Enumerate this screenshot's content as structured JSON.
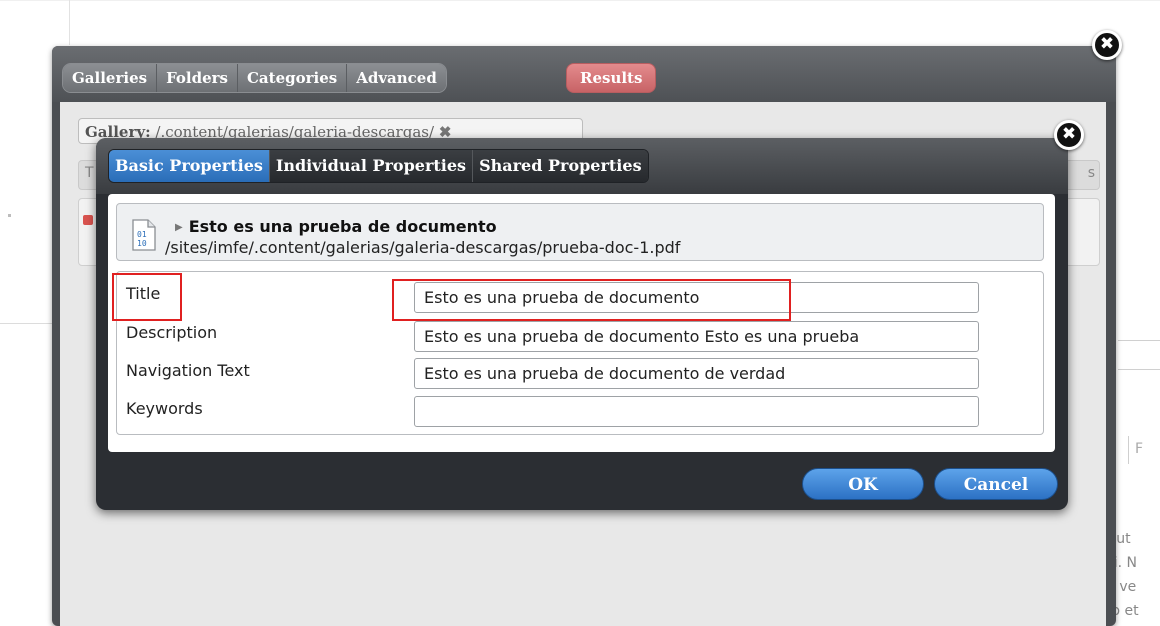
{
  "outer_tabs": [
    "Galleries",
    "Folders",
    "Categories",
    "Advanced"
  ],
  "results_tab": "Results",
  "filter": {
    "label": "Gallery:",
    "value": " /.content/galerias/galeria-descargas/",
    "remove": "✖"
  },
  "tab_strip_left": "T",
  "tab_strip_right": "s",
  "dialog": {
    "tabs": [
      "Basic Properties",
      "Individual Properties",
      "Shared Properties"
    ],
    "active_tab": "Basic Properties",
    "resource": {
      "icon": "document-binary-icon",
      "title": "Esto es una prueba de documento",
      "path": "/sites/imfe/.content/galerias/galeria-descargas/prueba-doc-1.pdf"
    },
    "properties": [
      {
        "label": "Title",
        "value": "Esto es una prueba de documento"
      },
      {
        "label": "Description",
        "value": "Esto es una prueba de documento Esto es una prueba"
      },
      {
        "label": "Navigation Text",
        "value": "Esto es una prueba de documento de verdad"
      },
      {
        "label": "Keywords",
        "value": ""
      }
    ],
    "ok_label": "OK",
    "cancel_label": "Cancel"
  },
  "close_symbol": "✖",
  "background_right": {
    "box_char": "F",
    "lines": [
      "r ut",
      "ci. N",
      "n ve",
      "ro et"
    ]
  },
  "colors": {
    "active_tab": "#2a6db8",
    "results_tab": "#c86366",
    "highlight": "#e02020"
  }
}
